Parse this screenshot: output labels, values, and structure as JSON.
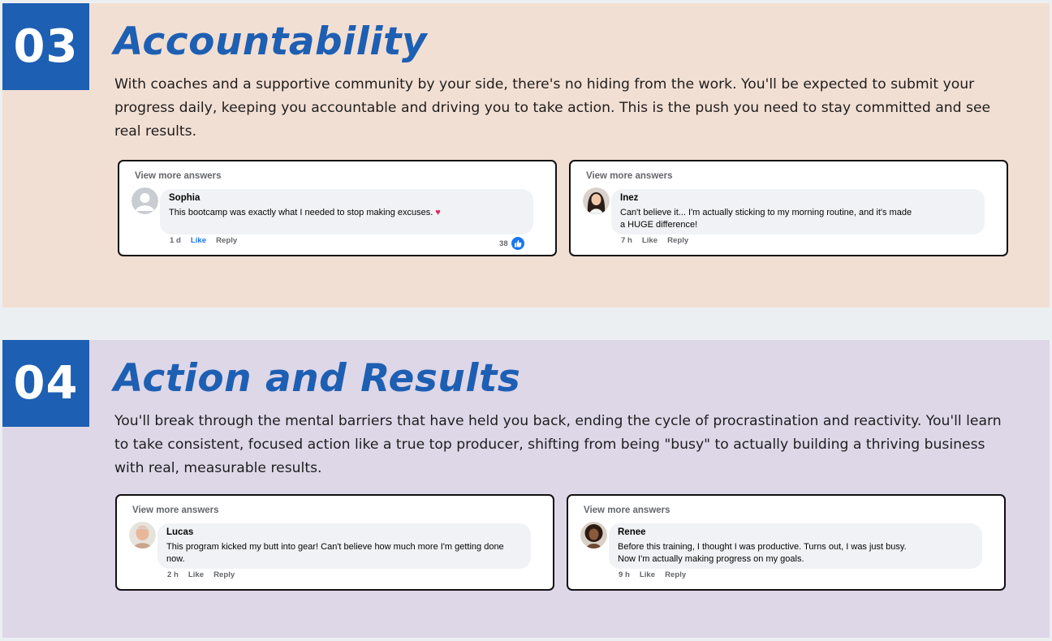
{
  "sections": [
    {
      "number": "03",
      "title": "Accountability",
      "description": "With coaches and a supportive community by your side, there's no hiding from the work. You'll be expected to submit your progress daily, keeping you accountable and driving you to take action. This is the push you need to stay committed and see real results.",
      "comments": [
        {
          "view_more": "View more answers",
          "author": "Sophia",
          "text": "This bootcamp was exactly what I needed to stop making excuses.",
          "time": "1 d",
          "like": "Like",
          "reply": "Reply",
          "reaction_count": "38"
        },
        {
          "view_more": "View more answers",
          "author": "Inez",
          "text": "Can't believe it... I'm actually sticking to my morning routine, and it's made a HUGE difference!",
          "time": "7 h",
          "like": "Like",
          "reply": "Reply"
        }
      ]
    },
    {
      "number": "04",
      "title": "Action and Results",
      "description": "You'll break through the mental barriers that have held you back, ending the cycle of procrastination and reactivity. You'll learn to take consistent, focused action like a true top producer, shifting from being \"busy\" to actually building a thriving business with real, measurable results.",
      "comments": [
        {
          "view_more": "View more answers",
          "author": "Lucas",
          "text": "This program kicked my butt into gear! Can't believe how much more I'm getting done now.",
          "time": "2 h",
          "like": "Like",
          "reply": "Reply"
        },
        {
          "view_more": "View more answers",
          "author": "Renee",
          "text": "Before this training, I thought I was productive. Turns out, I was just busy. Now I'm actually making progress on my goals.",
          "time": "9 h",
          "like": "Like",
          "reply": "Reply"
        }
      ]
    }
  ],
  "colors": {
    "accent_blue": "#1d5fb3",
    "section_03_bg": "#f2dfd3",
    "section_04_bg": "#ded7e8",
    "like_active": "#1877f2",
    "heart": "#e0245e"
  },
  "icons": [
    "heart-icon",
    "like-thumb-icon",
    "default-avatar-icon"
  ]
}
